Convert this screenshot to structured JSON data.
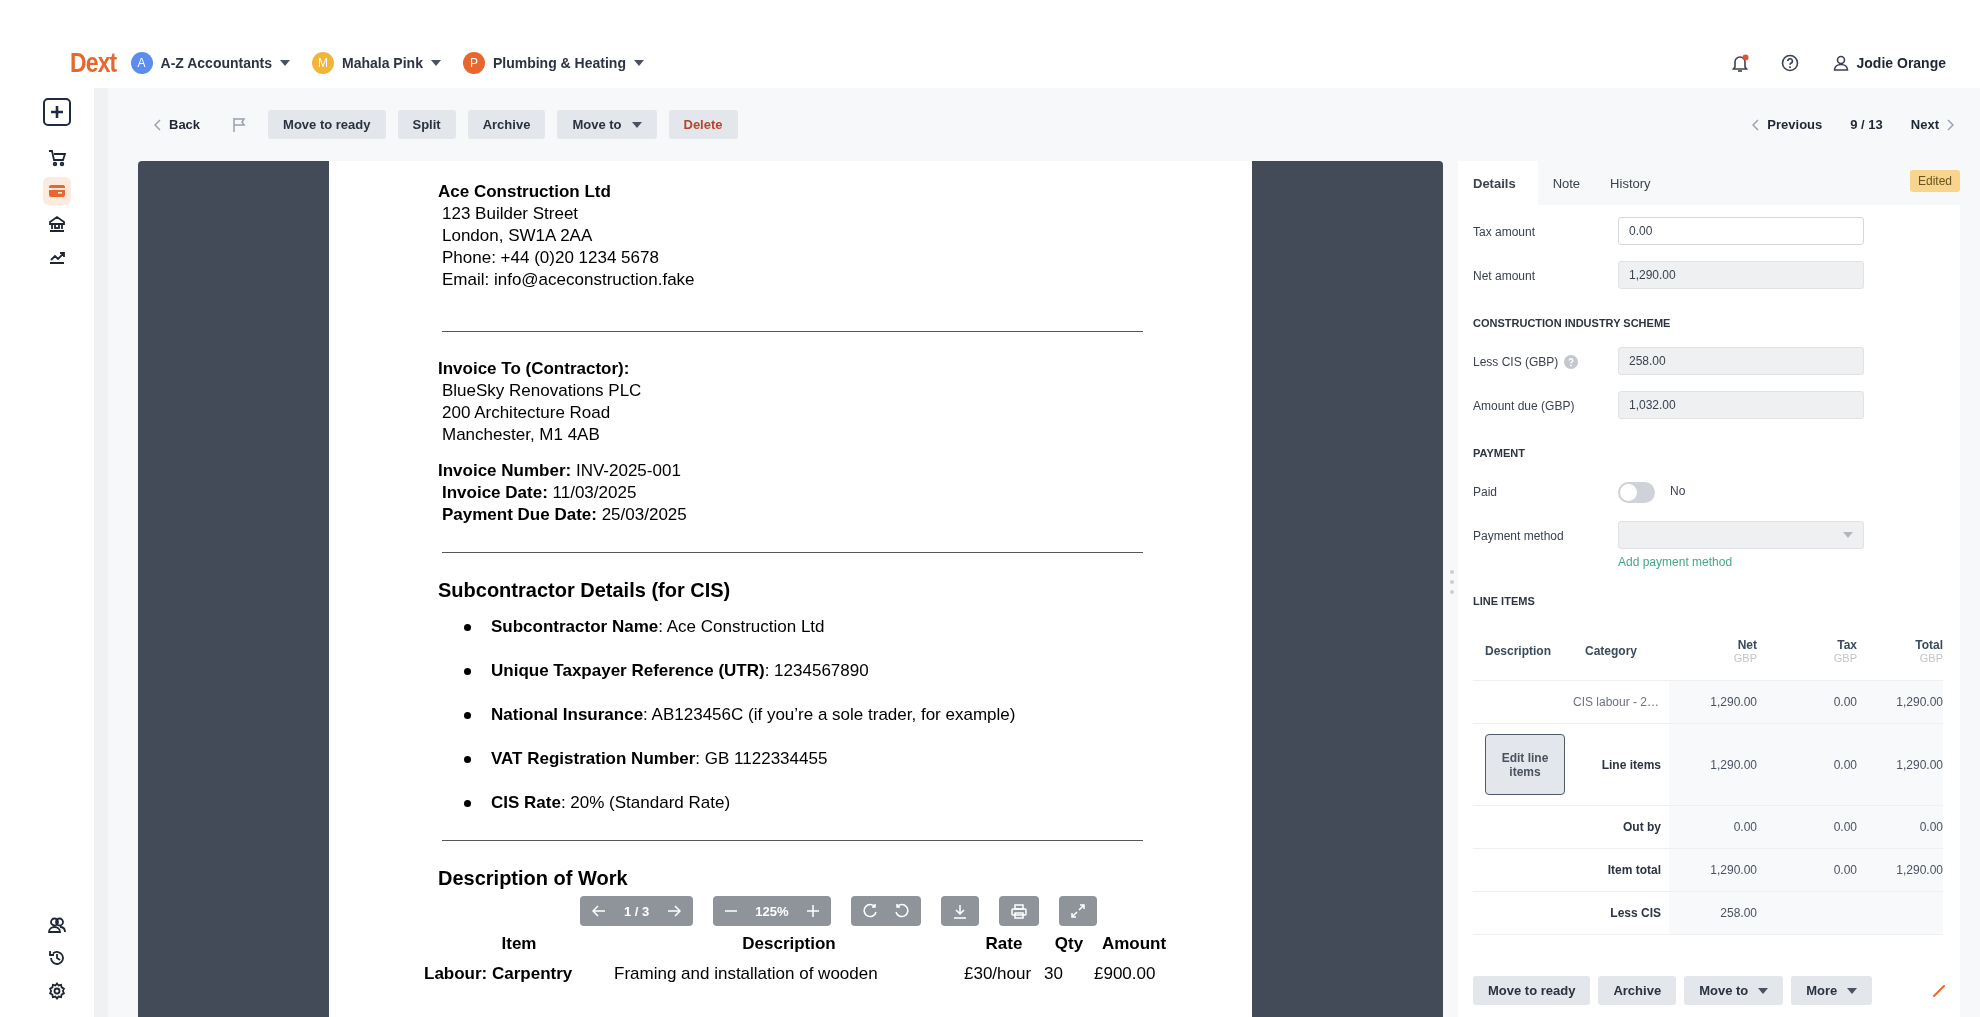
{
  "header": {
    "logo": "Dext",
    "workspaces": [
      {
        "initial": "A",
        "name": "A-Z Accountants",
        "color": "#5b8def"
      },
      {
        "initial": "M",
        "name": "Mahala Pink",
        "color": "#f2b53a"
      },
      {
        "initial": "P",
        "name": "Plumbing & Heating",
        "color": "#e8672e"
      }
    ],
    "notification": true,
    "user": "Jodie Orange"
  },
  "sidebar": {
    "top": [
      {
        "kind": "cart",
        "selected": false
      },
      {
        "kind": "card",
        "selected": true
      },
      {
        "kind": "bank",
        "selected": false
      },
      {
        "kind": "chart",
        "selected": false
      }
    ],
    "bottom": [
      {
        "kind": "people",
        "selected": false
      },
      {
        "kind": "history",
        "selected": false
      },
      {
        "kind": "settings",
        "selected": false
      }
    ]
  },
  "toolbar": {
    "back": "Back",
    "flagged": false,
    "buttons": [
      {
        "label": "Move to ready",
        "kind": "plain"
      },
      {
        "label": "Split",
        "kind": "plain"
      },
      {
        "label": "Archive",
        "kind": "plain"
      },
      {
        "label": "Move to",
        "kind": "dropdown"
      },
      {
        "label": "Delete",
        "kind": "danger"
      }
    ],
    "previous": "Previous",
    "position": "9 / 13",
    "next": "Next"
  },
  "document": {
    "blocks": [
      {
        "kind": "address",
        "title": "Ace Construction Ltd",
        "lines": [
          "123 Builder Street",
          "London, SW1A 2AA",
          "Phone: +44 (0)20 1234 5678",
          "Email: info@aceconstruction.fake"
        ]
      },
      {
        "kind": "rule"
      },
      {
        "kind": "address",
        "title": "Invoice To (Contractor):",
        "lines": [
          "BlueSky Renovations PLC",
          "200 Architecture Road",
          "Manchester, M1 4AB"
        ]
      },
      {
        "kind": "lines",
        "lines": [
          "**Invoice Number:** INV-2025-001",
          "**Invoice Date:** 11/03/2025",
          "**Payment Due Date:** 25/03/2025"
        ]
      },
      {
        "kind": "rule"
      },
      {
        "kind": "heading",
        "text": "Subcontractor Details (for CIS)"
      },
      {
        "kind": "bullets",
        "items": [
          "**Subcontractor Name**: Ace Construction Ltd",
          "**Unique Taxpayer Reference (UTR)**: 1234567890",
          "**National Insurance**: AB123456C (if you’re a sole trader, for example)",
          "**VAT Registration Number**: GB 1122334455",
          "**CIS Rate**: 20% (Standard Rate)"
        ]
      },
      {
        "kind": "rule"
      },
      {
        "kind": "heading",
        "text": "Description of Work"
      },
      {
        "kind": "table",
        "columns": [
          "Item",
          "Description",
          "Rate",
          "Qty",
          "Amount"
        ],
        "rows": [
          [
            "Labour: Carpentry",
            "Framing and installation of wooden",
            "£30/hour",
            "30",
            "£900.00"
          ]
        ]
      }
    ],
    "viewer": {
      "page": "1 / 3",
      "zoom": "125%"
    }
  },
  "panel": {
    "tabs": [
      {
        "label": "Details",
        "selected": true
      },
      {
        "label": "Note",
        "selected": false
      },
      {
        "label": "History",
        "selected": false
      }
    ],
    "badge": "Edited",
    "rows": [
      {
        "kind": "field",
        "label": "Tax amount",
        "value": "0.00",
        "editable": true
      },
      {
        "kind": "field",
        "label": "Net amount",
        "value": "1,290.00",
        "editable": false
      },
      {
        "kind": "heading",
        "text": "CONSTRUCTION INDUSTRY SCHEME"
      },
      {
        "kind": "field",
        "label": "Less CIS (GBP)",
        "value": "258.00",
        "editable": false,
        "help": true
      },
      {
        "kind": "field",
        "label": "Amount due (GBP)",
        "value": "1,032.00",
        "editable": false
      },
      {
        "kind": "heading",
        "text": "PAYMENT"
      },
      {
        "kind": "toggle",
        "label": "Paid",
        "on": false,
        "state": "No"
      },
      {
        "kind": "select",
        "label": "Payment method",
        "link": "Add payment method"
      },
      {
        "kind": "heading",
        "text": "LINE ITEMS"
      }
    ],
    "line_items": {
      "columns": [
        {
          "label": "Description"
        },
        {
          "label": "Category"
        },
        {
          "label": "Net",
          "unit": "GBP"
        },
        {
          "label": "Tax",
          "unit": "GBP"
        },
        {
          "label": "Total",
          "unit": "GBP"
        }
      ],
      "rows": [
        {
          "kind": "item",
          "category": "CIS labour - 2…",
          "net": "1,290.00",
          "tax": "0.00",
          "total": "1,290.00"
        },
        {
          "kind": "summary",
          "action": "Edit line items",
          "label": "Line items",
          "net": "1,290.00",
          "tax": "0.00",
          "total": "1,290.00"
        },
        {
          "kind": "summary",
          "label": "Out by",
          "net": "0.00",
          "tax": "0.00",
          "total": "0.00"
        },
        {
          "kind": "summary",
          "label": "Item total",
          "net": "1,290.00",
          "tax": "0.00",
          "total": "1,290.00"
        },
        {
          "kind": "summary",
          "label": "Less CIS",
          "net": "258.00"
        }
      ]
    },
    "footer_buttons": [
      {
        "label": "Move to ready",
        "kind": "plain"
      },
      {
        "label": "Archive",
        "kind": "plain"
      },
      {
        "label": "Move to",
        "kind": "dropdown"
      },
      {
        "label": "More",
        "kind": "dropdown"
      }
    ]
  }
}
